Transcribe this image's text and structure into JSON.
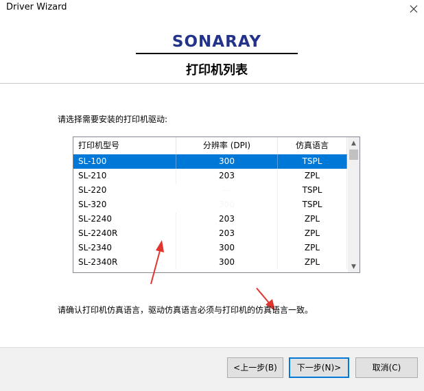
{
  "window": {
    "title": "Driver Wizard"
  },
  "header": {
    "brand": "SONARAY",
    "page_title": "打印机列表"
  },
  "instruction": "请选择需要安装的打印机驱动:",
  "table": {
    "columns": [
      "打印机型号",
      "分辨率 (DPI)",
      "仿真语言"
    ],
    "rows": [
      {
        "model": "SL-100",
        "dpi": "300",
        "lang": "TSPL",
        "selected": true
      },
      {
        "model": "SL-210",
        "dpi": "203",
        "lang": "ZPL"
      },
      {
        "model": "SL-220",
        "dpi": "---",
        "lang": "TSPL"
      },
      {
        "model": "SL-320",
        "dpi": "300",
        "lang": "TSPL"
      },
      {
        "model": "SL-2240",
        "dpi": "203",
        "lang": "ZPL"
      },
      {
        "model": "SL-2240R",
        "dpi": "203",
        "lang": "ZPL"
      },
      {
        "model": "SL-2340",
        "dpi": "300",
        "lang": "ZPL"
      },
      {
        "model": "SL-2340R",
        "dpi": "300",
        "lang": "ZPL"
      }
    ]
  },
  "confirm_text": "请确认打印机仿真语言，驱动仿真语言必须与打印机的仿真语言一致。",
  "buttons": {
    "back": "<上一步(B)",
    "next": "下一步(N)>",
    "cancel": "取消(C)"
  },
  "colors": {
    "selection": "#0078d7",
    "brand": "#24338a",
    "annotation_arrow": "#e0342f"
  },
  "icons": {
    "close": "close-icon",
    "scroll_up": "scroll-up-icon",
    "scroll_down": "scroll-down-icon",
    "annotation_arrow_left": "red-arrow-icon",
    "annotation_arrow_right": "red-arrow-icon"
  }
}
